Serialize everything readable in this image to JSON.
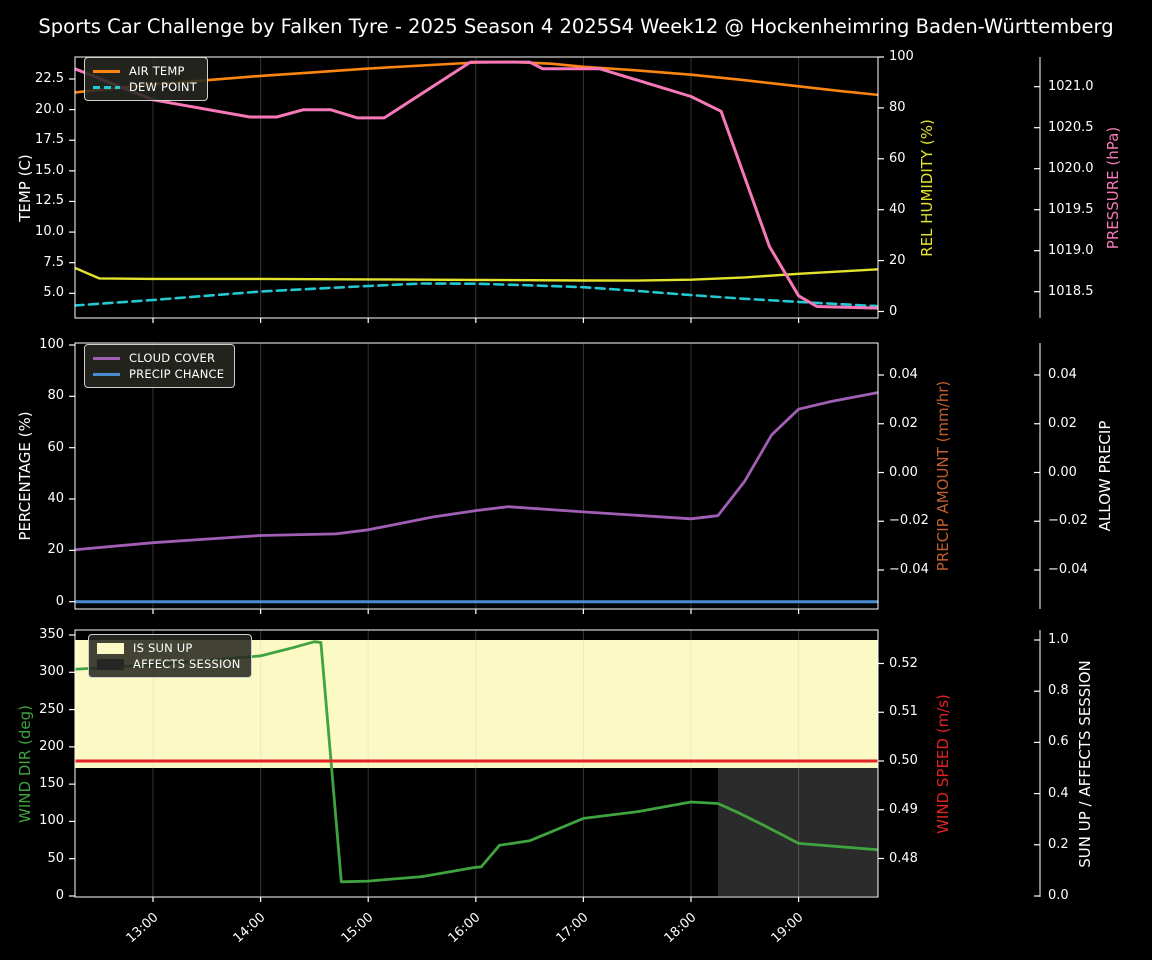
{
  "title": "Sports Car Challenge by Falken Tyre - 2025 Season 4 2025S4 Week12 @ Hockenheimring Baden-Württemberg",
  "x_axis": {
    "tick_labels": [
      "13:00",
      "14:00",
      "15:00",
      "16:00",
      "17:00",
      "18:00",
      "19:00"
    ],
    "tick_hours": [
      13,
      14,
      15,
      16,
      17,
      18,
      19
    ],
    "range_hours": [
      12.27,
      19.74
    ]
  },
  "chart_data": [
    {
      "type": "line",
      "left_axis": {
        "label": "TEMP (C)",
        "color": "#ffffff",
        "tick_labels": [
          "5.0",
          "7.5",
          "10.0",
          "12.5",
          "15.0",
          "17.5",
          "20.0",
          "22.5"
        ],
        "tick_values": [
          5,
          7.5,
          10,
          12.5,
          15,
          17.5,
          20,
          22.5
        ]
      },
      "right_axis_inner": {
        "label": "REL HUMIDITY (%)",
        "color": "#e3e32e",
        "tick_labels": [
          "0",
          "20",
          "40",
          "60",
          "80",
          "100"
        ],
        "tick_values": [
          0,
          20,
          40,
          60,
          80,
          100
        ]
      },
      "right_axis_outer": {
        "label": "PRESSURE (hPa)",
        "color": "#f678b8",
        "tick_labels": [
          "1018.5",
          "1019.0",
          "1019.5",
          "1020.0",
          "1020.5",
          "1021.0"
        ],
        "tick_values": [
          1018.5,
          1019,
          1019.5,
          1020,
          1020.5,
          1021
        ]
      },
      "legend": [
        {
          "label": "AIR TEMP",
          "color": "#fb8510",
          "style": "line"
        },
        {
          "label": "DEW POINT",
          "color": "#22c8d2",
          "style": "dashed"
        }
      ],
      "series": [
        {
          "name": "AIR TEMP",
          "axis": "left",
          "color": "#fb8510",
          "width": 2.6,
          "dash": false,
          "x": [
            12.27,
            12.6,
            13,
            13.5,
            14,
            14.5,
            15,
            15.5,
            16,
            16.33,
            16.7,
            17,
            17.5,
            18,
            18.5,
            19,
            19.4,
            19.74
          ],
          "y": [
            21.4,
            21.7,
            22.05,
            22.4,
            22.75,
            23.05,
            23.35,
            23.6,
            23.85,
            23.9,
            23.75,
            23.5,
            23.2,
            22.85,
            22.4,
            21.9,
            21.5,
            21.2
          ]
        },
        {
          "name": "DEW POINT",
          "axis": "left",
          "color": "#22c8d2",
          "width": 2.6,
          "dash": true,
          "x": [
            12.27,
            13,
            14,
            15,
            15.5,
            16,
            16.5,
            17,
            17.5,
            18,
            18.5,
            19,
            19.74
          ],
          "y": [
            4.0,
            4.45,
            5.15,
            5.6,
            5.8,
            5.78,
            5.65,
            5.5,
            5.2,
            4.85,
            4.55,
            4.3,
            3.95
          ]
        },
        {
          "name": "REL HUMIDITY",
          "axis": "inner",
          "color": "#e3e32e",
          "width": 2.4,
          "dash": false,
          "x": [
            12.27,
            12.5,
            13,
            14,
            15,
            16,
            17,
            17.5,
            18,
            18.5,
            19,
            19.74
          ],
          "y": [
            17.2,
            13.0,
            12.8,
            12.8,
            12.6,
            12.4,
            12.2,
            12.15,
            12.5,
            13.4,
            14.8,
            16.6
          ]
        },
        {
          "name": "PRESSURE",
          "axis": "outer",
          "color": "#f678b8",
          "width": 3,
          "dash": false,
          "x": [
            12.27,
            13,
            13.9,
            14.15,
            14.4,
            14.65,
            14.9,
            15.15,
            15.95,
            16.5,
            16.62,
            17.15,
            18.0,
            18.28,
            18.73,
            19.0,
            19.17,
            19.74
          ],
          "y": [
            1021.22,
            1020.84,
            1020.63,
            1020.63,
            1020.72,
            1020.72,
            1020.62,
            1020.62,
            1021.3,
            1021.3,
            1021.22,
            1021.22,
            1020.88,
            1020.7,
            1019.05,
            1018.45,
            1018.32,
            1018.3
          ]
        }
      ]
    },
    {
      "type": "line",
      "left_axis": {
        "label": "PERCENTAGE (%)",
        "color": "#ffffff",
        "tick_labels": [
          "0",
          "20",
          "40",
          "60",
          "80",
          "100"
        ],
        "tick_values": [
          0,
          20,
          40,
          60,
          80,
          100
        ]
      },
      "right_axis_inner": {
        "label": "PRECIP AMOUNT (mm/hr)",
        "color": "#c05f2e",
        "tick_labels": [
          "0.04",
          "0.02",
          "0.00",
          "−0.02",
          "−0.04"
        ],
        "tick_values": [
          0.04,
          0.02,
          0,
          -0.02,
          -0.04
        ]
      },
      "right_axis_outer": {
        "label": "ALLOW PRECIP",
        "color": "#ffffff",
        "tick_labels": [
          "0.04",
          "0.02",
          "0.00",
          "−0.02",
          "−0.04"
        ],
        "tick_values": [
          0.04,
          0.02,
          0,
          -0.02,
          -0.04
        ]
      },
      "legend": [
        {
          "label": "CLOUD COVER",
          "color": "#a05fb5",
          "style": "line"
        },
        {
          "label": "PRECIP CHANCE",
          "color": "#4a8cd0",
          "style": "line"
        }
      ],
      "series": [
        {
          "name": "CLOUD COVER",
          "axis": "left",
          "color": "#a05fb5",
          "width": 2.8,
          "dash": false,
          "x": [
            12.27,
            13,
            14,
            14.7,
            15,
            15.6,
            16,
            16.3,
            17,
            18,
            18.25,
            18.5,
            18.75,
            19,
            19.3,
            19.74
          ],
          "y": [
            20.2,
            23,
            25.8,
            26.4,
            28,
            33,
            35.5,
            37,
            35,
            32.3,
            33.5,
            47,
            65,
            75,
            78,
            81.5
          ]
        },
        {
          "name": "PRECIP CHANCE",
          "axis": "left",
          "color": "#4a8cd0",
          "width": 3,
          "dash": false,
          "x": [
            12.27,
            19.74
          ],
          "y": [
            0,
            0
          ]
        }
      ]
    },
    {
      "type": "line",
      "left_axis": {
        "label": "WIND DIR (deg)",
        "color": "#3fa33f",
        "tick_labels": [
          "0",
          "50",
          "100",
          "150",
          "200",
          "250",
          "300",
          "350"
        ],
        "tick_values": [
          0,
          50,
          100,
          150,
          200,
          250,
          300,
          350
        ]
      },
      "right_axis_inner": {
        "label": "WIND SPEED (m/s)",
        "color": "#e32222",
        "tick_labels": [
          "0.48",
          "0.49",
          "0.50",
          "0.51",
          "0.52"
        ],
        "tick_values": [
          0.48,
          0.49,
          0.5,
          0.51,
          0.52
        ]
      },
      "right_axis_outer": {
        "label": "SUN UP / AFFECTS SESSION",
        "color": "#ffffff",
        "tick_labels": [
          "0.0",
          "0.2",
          "0.4",
          "0.6",
          "0.8",
          "1.0"
        ],
        "tick_values": [
          0,
          0.2,
          0.4,
          0.6,
          0.8,
          1
        ]
      },
      "legend": [
        {
          "label": "IS SUN UP",
          "color": "#fbfac5",
          "style": "patch"
        },
        {
          "label": "AFFECTS SESSION",
          "color": "#262626",
          "style": "patch"
        }
      ],
      "bands": [
        {
          "name": "IS SUN UP",
          "axis": "outer",
          "color": "#fbfac5",
          "x": [
            12.27,
            19.74
          ],
          "v": [
            0.5,
            1.0
          ]
        },
        {
          "name": "AFFECTS SESSION",
          "axis": "outer",
          "color": "#2b2b2b",
          "x": [
            18.25,
            19.74
          ],
          "v": [
            0.0,
            0.5
          ]
        }
      ],
      "series": [
        {
          "name": "WIND DIR",
          "axis": "left",
          "color": "#3fa33f",
          "width": 2.8,
          "dash": false,
          "x": [
            12.27,
            13,
            13.5,
            14,
            14.3,
            14.5,
            14.56,
            14.75,
            15,
            15.5,
            16,
            16.05,
            16.22,
            16.5,
            17,
            17.5,
            18,
            18.25,
            18.45,
            18.7,
            19,
            19.74
          ],
          "y": [
            304,
            310,
            316,
            322,
            333,
            341,
            340,
            19,
            20,
            26,
            38.5,
            39,
            68,
            74,
            104,
            113,
            126,
            124,
            111,
            93,
            70.5,
            62
          ]
        },
        {
          "name": "WIND SPEED",
          "axis": "inner",
          "color": "#e32222",
          "width": 3,
          "dash": false,
          "x": [
            12.27,
            19.74
          ],
          "y": [
            0.5,
            0.5
          ]
        }
      ]
    }
  ]
}
